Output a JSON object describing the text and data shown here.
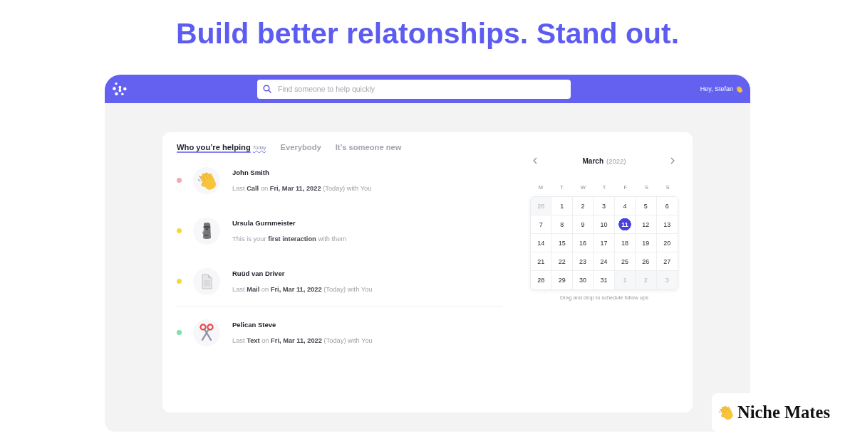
{
  "headline": "Build better relatonships. Stand out.",
  "header": {
    "search": {
      "placeholder": "Find someone to help quickly"
    },
    "greeting": "Hey, Stefan"
  },
  "tabs": [
    {
      "label": "Who you’re helping",
      "badge": "Today",
      "selected": true
    },
    {
      "label": "Everybody",
      "selected": false
    },
    {
      "label": "It’s someone new",
      "selected": false
    }
  ],
  "contact_groups": [
    {
      "contacts": [
        {
          "name": "John Smith",
          "color": "#f4a7b4",
          "detail": "Last **Call** on **Fri, Mar 11, 2022** (Today) with You"
        },
        {
          "name": "Ursula Gurnmeister",
          "color": "#f7d83a",
          "detail": "This is your **first interaction** with them"
        },
        {
          "name": "Ruüd van Driver",
          "color": "#f7d83a",
          "detail": "Last **Mail** on **Fri, Mar 11, 2022** (Today) with You"
        }
      ]
    },
    {
      "contacts": [
        {
          "name": "Pelican Steve",
          "color": "#7be3a4",
          "detail": "Last **Text** on **Fri, Mar 11, 2022** (Today) with You"
        }
      ]
    }
  ],
  "calendar": {
    "month": "March",
    "year": "(2022)",
    "weekdays": [
      "M",
      "T",
      "W",
      "T",
      "F",
      "S",
      "S"
    ],
    "days": [
      {
        "label": "28",
        "outside": true,
        "selected": false
      },
      {
        "label": "1",
        "outside": false,
        "selected": false
      },
      {
        "label": "2",
        "outside": false,
        "selected": false
      },
      {
        "label": "3",
        "outside": false,
        "selected": false
      },
      {
        "label": "4",
        "outside": false,
        "selected": false
      },
      {
        "label": "5",
        "outside": false,
        "selected": false
      },
      {
        "label": "6",
        "outside": false,
        "selected": false
      },
      {
        "label": "7",
        "outside": false,
        "selected": false
      },
      {
        "label": "8",
        "outside": false,
        "selected": false
      },
      {
        "label": "9",
        "outside": false,
        "selected": false
      },
      {
        "label": "10",
        "outside": false,
        "selected": false
      },
      {
        "label": "11",
        "outside": false,
        "selected": true
      },
      {
        "label": "12",
        "outside": false,
        "selected": false
      },
      {
        "label": "13",
        "outside": false,
        "selected": false
      },
      {
        "label": "14",
        "outside": false,
        "selected": false
      },
      {
        "label": "15",
        "outside": false,
        "selected": false
      },
      {
        "label": "16",
        "outside": false,
        "selected": false
      },
      {
        "label": "17",
        "outside": false,
        "selected": false
      },
      {
        "label": "18",
        "outside": false,
        "selected": false
      },
      {
        "label": "19",
        "outside": false,
        "selected": false
      },
      {
        "label": "20",
        "outside": false,
        "selected": false
      },
      {
        "label": "21",
        "outside": false,
        "selected": false
      },
      {
        "label": "22",
        "outside": false,
        "selected": false
      },
      {
        "label": "23",
        "outside": false,
        "selected": false
      },
      {
        "label": "24",
        "outside": false,
        "selected": false
      },
      {
        "label": "25",
        "outside": false,
        "selected": false
      },
      {
        "label": "26",
        "outside": false,
        "selected": false
      },
      {
        "label": "27",
        "outside": false,
        "selected": false
      },
      {
        "label": "28",
        "outside": false,
        "selected": false
      },
      {
        "label": "29",
        "outside": false,
        "selected": false
      },
      {
        "label": "30",
        "outside": false,
        "selected": false
      },
      {
        "label": "31",
        "outside": false,
        "selected": false
      },
      {
        "label": "1",
        "outside": true,
        "selected": false
      },
      {
        "label": "2",
        "outside": true,
        "selected": false
      },
      {
        "label": "3",
        "outside": true,
        "selected": false
      }
    ],
    "caption": "Drag and drop to schedule follow ups"
  },
  "brand": {
    "name": "Niche Mates"
  }
}
